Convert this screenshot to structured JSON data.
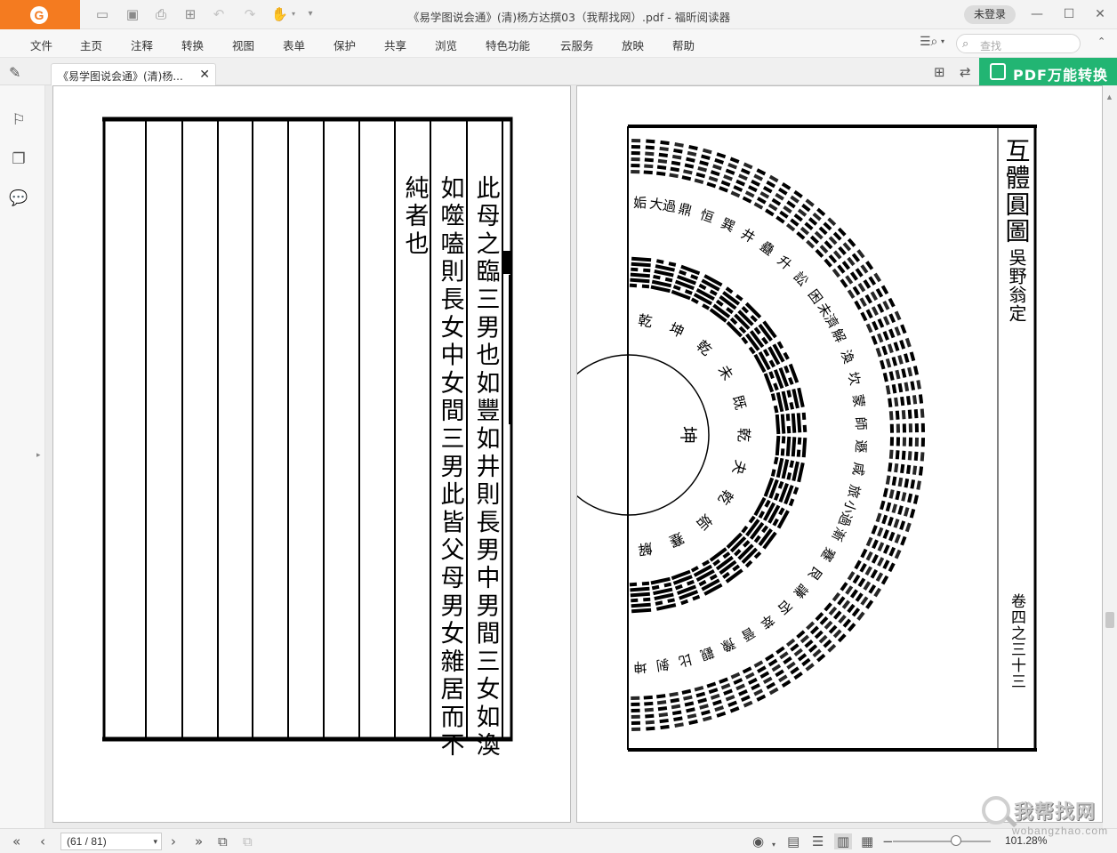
{
  "app": {
    "window_title": "《易学图说会通》(清)杨方达撰03（我帮找网）.pdf - 福昕阅读器",
    "login_label": "未登录"
  },
  "menu": {
    "items": [
      "文件",
      "主页",
      "注释",
      "转换",
      "视图",
      "表单",
      "保护",
      "共享",
      "浏览",
      "特色功能",
      "云服务",
      "放映",
      "帮助"
    ],
    "search_placeholder": "查找"
  },
  "tab": {
    "label": "《易学图说会通》(清)杨..."
  },
  "promo": {
    "label": "PDF万能转换"
  },
  "left_page": {
    "columns": [
      "此母之臨三男也如豐如井則長男中男間三女如渙",
      "如噬嗑則長女中女間三男此皆父母男女雜居而不",
      "純者也"
    ]
  },
  "right_page": {
    "title": "互體圓圖",
    "author": "吳野翁定",
    "folio": "卷四之三十三",
    "center": "坤",
    "inner_labels": [
      "乾",
      "坤",
      "乾",
      "未",
      "既",
      "乾",
      "夬",
      "乾",
      "姤",
      "蹇",
      "解"
    ],
    "outer_labels": [
      "姤",
      "大過",
      "鼎",
      "恒",
      "巽",
      "井",
      "蠱",
      "升",
      "訟",
      "困",
      "未濟",
      "解",
      "渙",
      "坎",
      "蒙",
      "師",
      "遯",
      "咸",
      "旅",
      "小過",
      "漸",
      "蹇",
      "艮",
      "謙",
      "否",
      "萃",
      "晉",
      "豫",
      "觀",
      "比",
      "剝",
      "坤"
    ]
  },
  "status": {
    "page_indicator": "(61 / 81)",
    "zoom": "101.28%"
  },
  "watermark": {
    "big": "我帮找网",
    "small": "wobangzhao.com"
  }
}
